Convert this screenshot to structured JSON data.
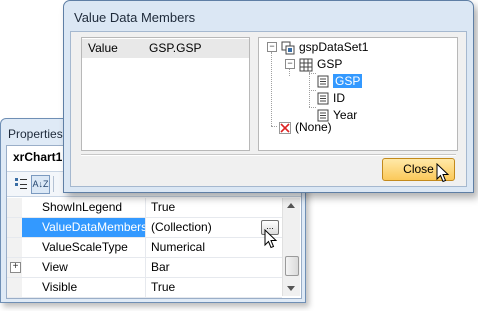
{
  "properties_window": {
    "title": "Properties",
    "object_name": "xrChart1",
    "toolbar": {
      "categorized_icon": "categorized-icon",
      "alphabetical_label": "A↓Z"
    },
    "rows": [
      {
        "name": "ShowInLegend",
        "value": "True",
        "expandable": false,
        "selected": false
      },
      {
        "name": "ValueDataMembers",
        "value": "(Collection)",
        "expandable": false,
        "selected": true,
        "editor_button": "..."
      },
      {
        "name": "ValueScaleType",
        "value": "Numerical",
        "expandable": false,
        "selected": false
      },
      {
        "name": "View",
        "value": "Bar",
        "expandable": true,
        "selected": false
      },
      {
        "name": "Visible",
        "value": "True",
        "expandable": false,
        "selected": false
      }
    ]
  },
  "dialog": {
    "title": "Value Data Members",
    "member": {
      "key": "Value",
      "value": "GSP.GSP"
    },
    "tree": {
      "root": "gspDataSet1",
      "table": "GSP",
      "fields": [
        "GSP",
        "ID",
        "Year"
      ],
      "selected_field": "GSP",
      "none_item": "(None)"
    },
    "close_label": "Close"
  },
  "colors": {
    "selection": "#3399ff",
    "window_frame": "#dbe7f4",
    "close_button": "#fbc95a"
  }
}
